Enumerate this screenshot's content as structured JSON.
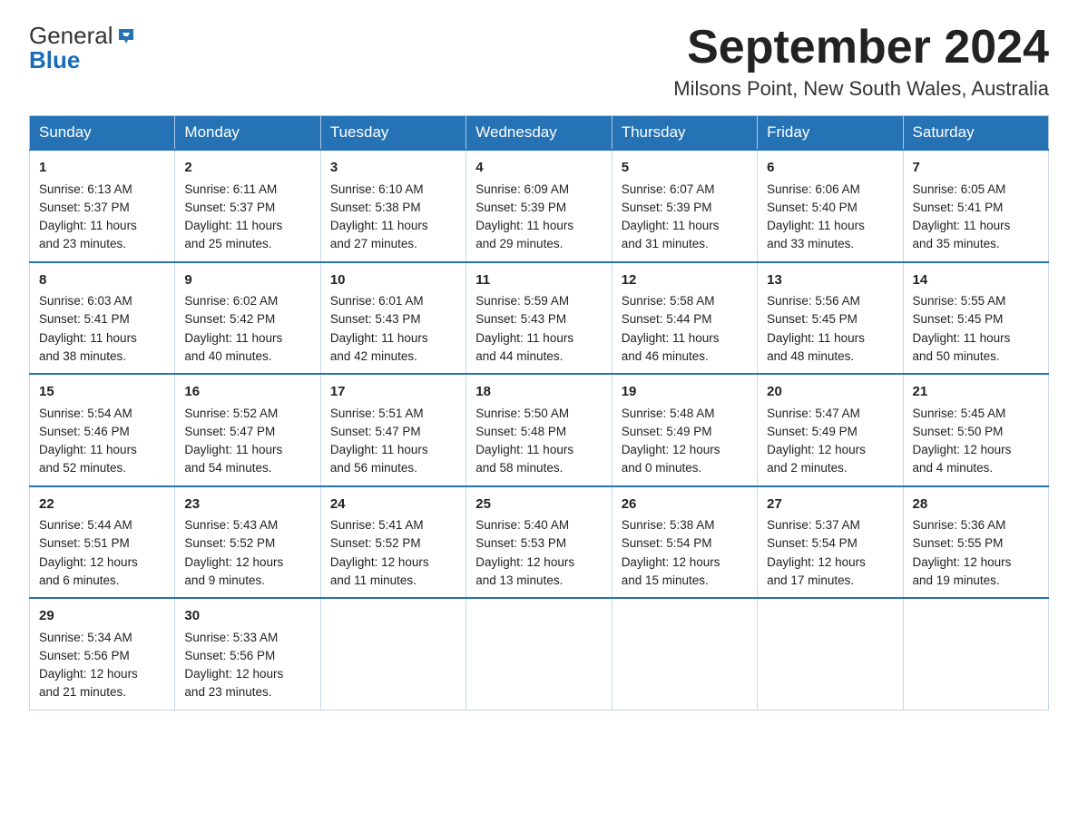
{
  "header": {
    "logo": {
      "general": "General",
      "blue": "Blue"
    },
    "title": "September 2024",
    "location": "Milsons Point, New South Wales, Australia"
  },
  "days": [
    "Sunday",
    "Monday",
    "Tuesday",
    "Wednesday",
    "Thursday",
    "Friday",
    "Saturday"
  ],
  "weeks": [
    [
      {
        "date": "1",
        "sunrise": "6:13 AM",
        "sunset": "5:37 PM",
        "daylight": "11 hours and 23 minutes."
      },
      {
        "date": "2",
        "sunrise": "6:11 AM",
        "sunset": "5:37 PM",
        "daylight": "11 hours and 25 minutes."
      },
      {
        "date": "3",
        "sunrise": "6:10 AM",
        "sunset": "5:38 PM",
        "daylight": "11 hours and 27 minutes."
      },
      {
        "date": "4",
        "sunrise": "6:09 AM",
        "sunset": "5:39 PM",
        "daylight": "11 hours and 29 minutes."
      },
      {
        "date": "5",
        "sunrise": "6:07 AM",
        "sunset": "5:39 PM",
        "daylight": "11 hours and 31 minutes."
      },
      {
        "date": "6",
        "sunrise": "6:06 AM",
        "sunset": "5:40 PM",
        "daylight": "11 hours and 33 minutes."
      },
      {
        "date": "7",
        "sunrise": "6:05 AM",
        "sunset": "5:41 PM",
        "daylight": "11 hours and 35 minutes."
      }
    ],
    [
      {
        "date": "8",
        "sunrise": "6:03 AM",
        "sunset": "5:41 PM",
        "daylight": "11 hours and 38 minutes."
      },
      {
        "date": "9",
        "sunrise": "6:02 AM",
        "sunset": "5:42 PM",
        "daylight": "11 hours and 40 minutes."
      },
      {
        "date": "10",
        "sunrise": "6:01 AM",
        "sunset": "5:43 PM",
        "daylight": "11 hours and 42 minutes."
      },
      {
        "date": "11",
        "sunrise": "5:59 AM",
        "sunset": "5:43 PM",
        "daylight": "11 hours and 44 minutes."
      },
      {
        "date": "12",
        "sunrise": "5:58 AM",
        "sunset": "5:44 PM",
        "daylight": "11 hours and 46 minutes."
      },
      {
        "date": "13",
        "sunrise": "5:56 AM",
        "sunset": "5:45 PM",
        "daylight": "11 hours and 48 minutes."
      },
      {
        "date": "14",
        "sunrise": "5:55 AM",
        "sunset": "5:45 PM",
        "daylight": "11 hours and 50 minutes."
      }
    ],
    [
      {
        "date": "15",
        "sunrise": "5:54 AM",
        "sunset": "5:46 PM",
        "daylight": "11 hours and 52 minutes."
      },
      {
        "date": "16",
        "sunrise": "5:52 AM",
        "sunset": "5:47 PM",
        "daylight": "11 hours and 54 minutes."
      },
      {
        "date": "17",
        "sunrise": "5:51 AM",
        "sunset": "5:47 PM",
        "daylight": "11 hours and 56 minutes."
      },
      {
        "date": "18",
        "sunrise": "5:50 AM",
        "sunset": "5:48 PM",
        "daylight": "11 hours and 58 minutes."
      },
      {
        "date": "19",
        "sunrise": "5:48 AM",
        "sunset": "5:49 PM",
        "daylight": "12 hours and 0 minutes."
      },
      {
        "date": "20",
        "sunrise": "5:47 AM",
        "sunset": "5:49 PM",
        "daylight": "12 hours and 2 minutes."
      },
      {
        "date": "21",
        "sunrise": "5:45 AM",
        "sunset": "5:50 PM",
        "daylight": "12 hours and 4 minutes."
      }
    ],
    [
      {
        "date": "22",
        "sunrise": "5:44 AM",
        "sunset": "5:51 PM",
        "daylight": "12 hours and 6 minutes."
      },
      {
        "date": "23",
        "sunrise": "5:43 AM",
        "sunset": "5:52 PM",
        "daylight": "12 hours and 9 minutes."
      },
      {
        "date": "24",
        "sunrise": "5:41 AM",
        "sunset": "5:52 PM",
        "daylight": "12 hours and 11 minutes."
      },
      {
        "date": "25",
        "sunrise": "5:40 AM",
        "sunset": "5:53 PM",
        "daylight": "12 hours and 13 minutes."
      },
      {
        "date": "26",
        "sunrise": "5:38 AM",
        "sunset": "5:54 PM",
        "daylight": "12 hours and 15 minutes."
      },
      {
        "date": "27",
        "sunrise": "5:37 AM",
        "sunset": "5:54 PM",
        "daylight": "12 hours and 17 minutes."
      },
      {
        "date": "28",
        "sunrise": "5:36 AM",
        "sunset": "5:55 PM",
        "daylight": "12 hours and 19 minutes."
      }
    ],
    [
      {
        "date": "29",
        "sunrise": "5:34 AM",
        "sunset": "5:56 PM",
        "daylight": "12 hours and 21 minutes."
      },
      {
        "date": "30",
        "sunrise": "5:33 AM",
        "sunset": "5:56 PM",
        "daylight": "12 hours and 23 minutes."
      },
      null,
      null,
      null,
      null,
      null
    ]
  ],
  "labels": {
    "sunrise": "Sunrise:",
    "sunset": "Sunset:",
    "daylight": "Daylight:"
  }
}
